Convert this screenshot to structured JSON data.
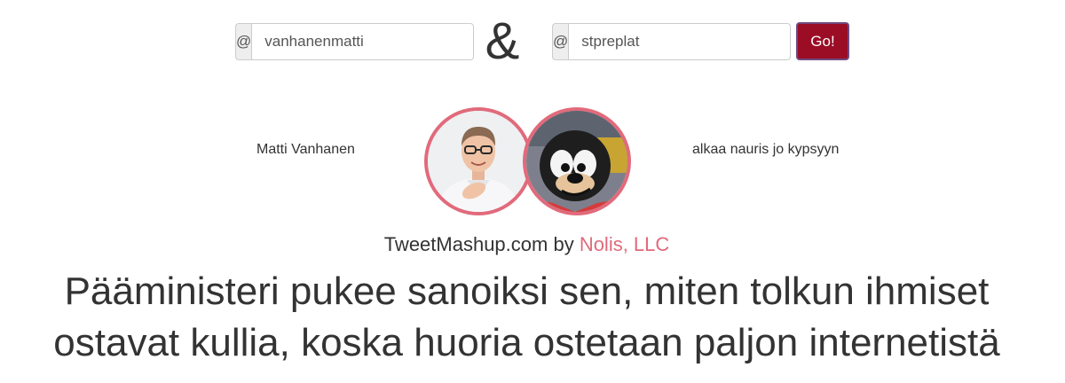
{
  "form": {
    "left": {
      "prefix": "@",
      "value": "vanhanenmatti"
    },
    "connector": "&",
    "right": {
      "prefix": "@",
      "value": "stpreplat"
    },
    "go_label": "Go!"
  },
  "profiles": {
    "left": {
      "name": "Matti Vanhanen",
      "avatar_icon": "man-portrait"
    },
    "right": {
      "name": "alkaa nauris jo kypsyyn",
      "avatar_icon": "cartoon-dog-portrait"
    }
  },
  "credit": {
    "site": "TweetMashup.com by",
    "company": "Nolis, LLC"
  },
  "mashup": {
    "line1": "Pääministeri pukee sanoiksi sen, miten tolkun ihmiset",
    "line2": "ostavat kullia, koska huoria ostetaan paljon internetistä"
  },
  "colors": {
    "accent": "#e16a7b",
    "button": "#9b0d25"
  }
}
